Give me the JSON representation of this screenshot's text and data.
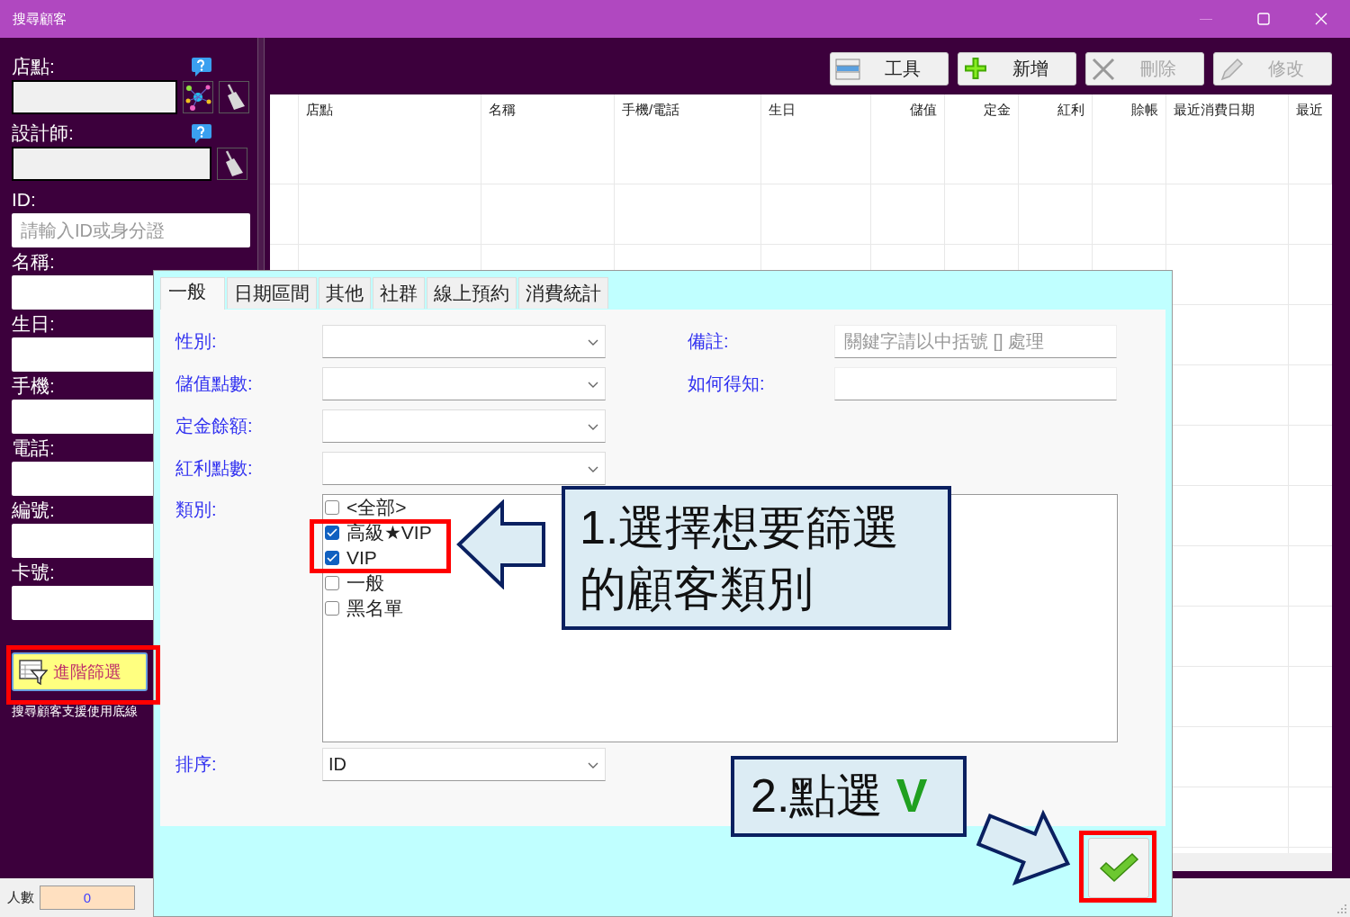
{
  "window": {
    "title": "搜尋顧客"
  },
  "filters": [
    {
      "kind": "multipick",
      "label": "店點:",
      "help": true
    },
    {
      "kind": "pick",
      "label": "設計師:",
      "help": true
    },
    {
      "kind": "text",
      "label": "ID:",
      "placeholder": "請輸入ID或身分證"
    },
    {
      "kind": "text",
      "label": "名稱:"
    },
    {
      "kind": "text",
      "label": "生日:"
    },
    {
      "kind": "text",
      "label": "手機:"
    },
    {
      "kind": "text",
      "label": "電話:"
    },
    {
      "kind": "text",
      "label": "編號:"
    },
    {
      "kind": "text",
      "label": "卡號:"
    }
  ],
  "advanced_filter": {
    "label": "進階篩選"
  },
  "hint": "搜尋顧客支援使用底線",
  "toolbar": [
    {
      "kind": "tools",
      "label": "工具",
      "disabled": false
    },
    {
      "kind": "add",
      "label": "新增",
      "disabled": false
    },
    {
      "kind": "delete",
      "label": "刪除",
      "disabled": true
    },
    {
      "kind": "edit",
      "label": "修改",
      "disabled": true
    }
  ],
  "table": {
    "columns": [
      {
        "label": "店點",
        "kind": "text"
      },
      {
        "label": "名稱",
        "kind": "text"
      },
      {
        "label": "手機/電話",
        "kind": "text"
      },
      {
        "label": "生日",
        "kind": "text"
      },
      {
        "label": "儲值",
        "kind": "number"
      },
      {
        "label": "定金",
        "kind": "number"
      },
      {
        "label": "紅利",
        "kind": "number"
      },
      {
        "label": "賒帳",
        "kind": "number"
      },
      {
        "label": "最近消費日期",
        "kind": "text"
      },
      {
        "label": "最近",
        "kind": "text"
      }
    ]
  },
  "status_bar": {
    "label": "人數",
    "value": "0"
  },
  "dialog": {
    "tabs": [
      {
        "label": "一般",
        "selected": true
      },
      {
        "label": "日期區間",
        "selected": false
      },
      {
        "label": "其他",
        "selected": false
      },
      {
        "label": "社群",
        "selected": false
      },
      {
        "label": "線上預約",
        "selected": false
      },
      {
        "label": "消費統計",
        "selected": false
      }
    ],
    "fields": [
      {
        "label": "性別:",
        "kind": "dropdown"
      },
      {
        "label": "儲值點數:",
        "kind": "dropdown"
      },
      {
        "label": "定金餘額:",
        "kind": "dropdown"
      },
      {
        "label": "紅利點數:",
        "kind": "dropdown"
      }
    ],
    "side_fields": [
      {
        "label": "備註:",
        "placeholder": "關鍵字請以中括號 [] 處理"
      },
      {
        "label": "如何得知:"
      }
    ],
    "category": {
      "label": "類別:",
      "options": [
        {
          "label": "<全部>",
          "checked": false
        },
        {
          "label": "高級★VIP",
          "checked": true
        },
        {
          "label": "VIP",
          "checked": true
        },
        {
          "label": "一般",
          "checked": false
        },
        {
          "label": "黑名單",
          "checked": false
        }
      ]
    },
    "sort": {
      "label": "排序:",
      "value": "ID"
    }
  },
  "annotations": [
    {
      "kind": "note",
      "lines": [
        "1.選擇想要篩選",
        "的顧客類別"
      ]
    },
    {
      "kind": "step",
      "text": "2.點選",
      "mark": "V"
    }
  ]
}
